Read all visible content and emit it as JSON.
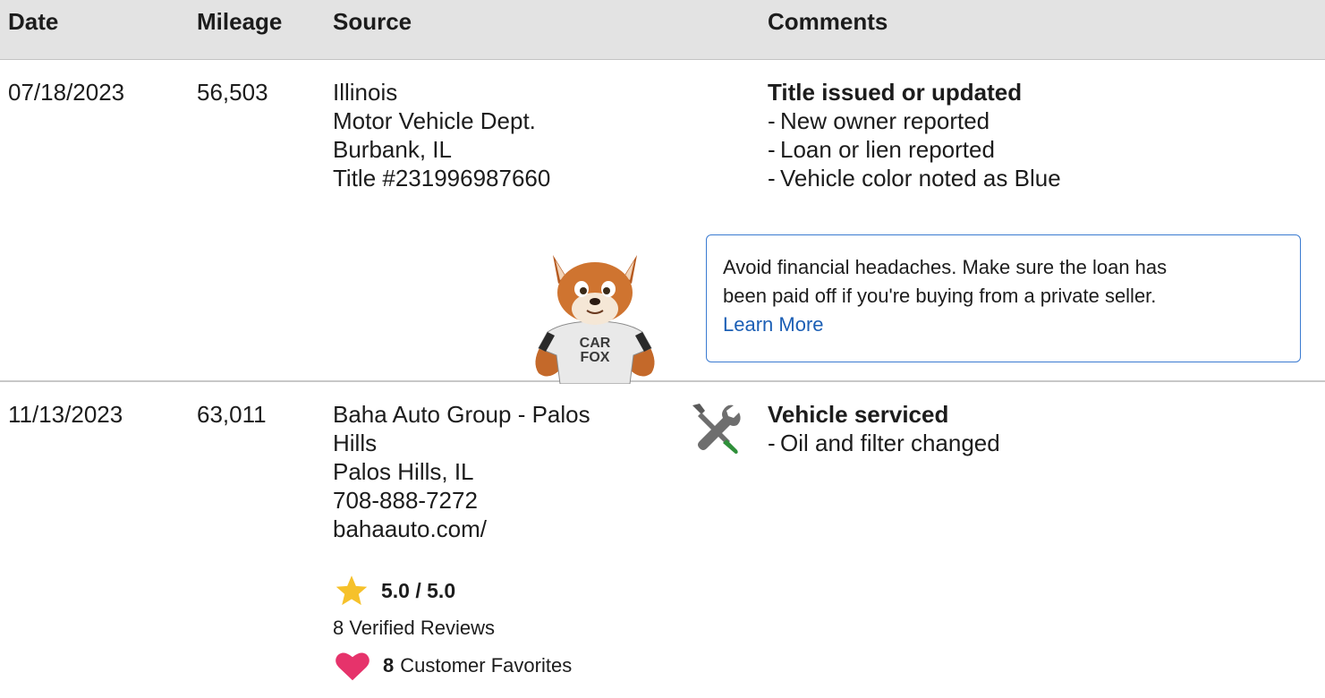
{
  "header": {
    "date": "Date",
    "mileage": "Mileage",
    "source": "Source",
    "comments": "Comments"
  },
  "records": [
    {
      "date": "07/18/2023",
      "mileage": "56,503",
      "source_lines": [
        "Illinois",
        "Motor Vehicle Dept.",
        "Burbank, IL",
        "Title #231996987660"
      ],
      "comment_title": "Title issued or updated",
      "comment_items": [
        "New owner reported",
        "Loan or lien reported",
        "Vehicle color noted as Blue"
      ],
      "tip": {
        "text_line1": "Avoid financial headaches. Make sure the loan has",
        "text_line2": "been paid off if you're buying from a private seller.",
        "link": "Learn More"
      },
      "mascot": {
        "shirt_line1": "CAR",
        "shirt_line2": "FOX",
        "icon": "carfox-mascot"
      }
    },
    {
      "date": "11/13/2023",
      "mileage": "63,011",
      "source_lines": [
        "Baha Auto Group - Palos",
        "Hills",
        "Palos Hills, IL",
        "708-888-7272",
        "bahaauto.com/"
      ],
      "rating": {
        "value": "5.0 / 5.0",
        "reviews": "8 Verified Reviews",
        "favorites_count": "8",
        "favorites_label": "Customer Favorites"
      },
      "comment_icon": "tools-icon",
      "comment_title": "Vehicle serviced",
      "comment_items": [
        "Oil and filter changed"
      ]
    }
  ],
  "colors": {
    "header_bg": "#e3e3e3",
    "tip_border": "#3b7bd1",
    "star": "#f6c12a",
    "heart": "#e6336b",
    "wrench_green": "#2f8f3a"
  }
}
